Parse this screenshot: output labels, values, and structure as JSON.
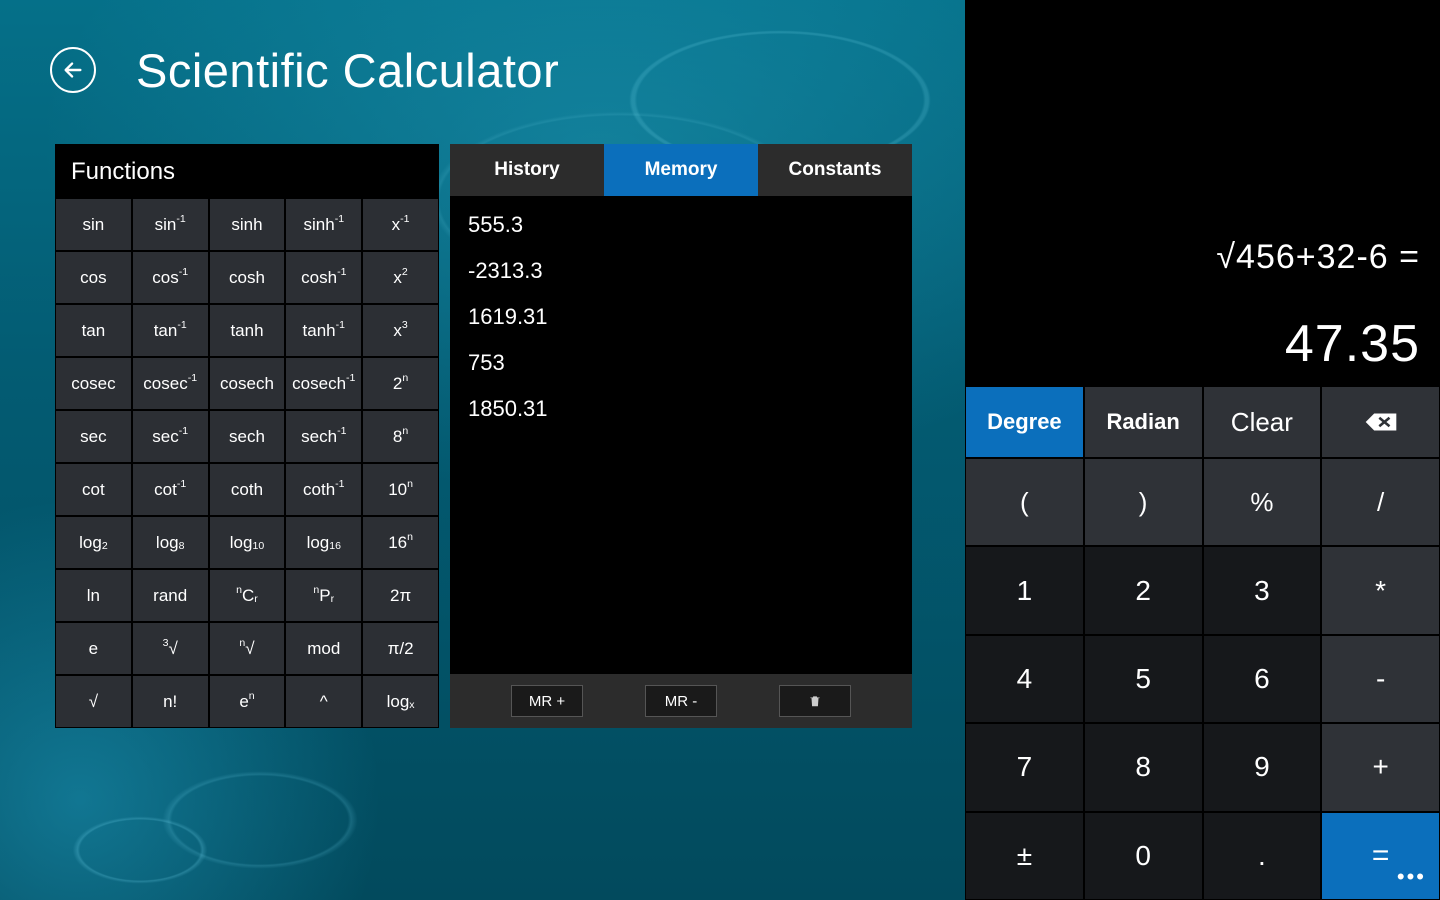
{
  "header": {
    "title": "Scientific Calculator"
  },
  "functions": {
    "title": "Functions",
    "rows": [
      [
        "sin",
        "sin<sup>-1</sup>",
        "sinh",
        "sinh<sup>-1</sup>",
        "x<sup>-1</sup>"
      ],
      [
        "cos",
        "cos<sup>-1</sup>",
        "cosh",
        "cosh<sup>-1</sup>",
        "x<sup>2</sup>"
      ],
      [
        "tan",
        "tan<sup>-1</sup>",
        "tanh",
        "tanh<sup>-1</sup>",
        "x<sup>3</sup>"
      ],
      [
        "cosec",
        "cosec<sup>-1</sup>",
        "cosech",
        "cosech<sup>-1</sup>",
        "2<sup>n</sup>"
      ],
      [
        "sec",
        "sec<sup>-1</sup>",
        "sech",
        "sech<sup>-1</sup>",
        "8<sup>n</sup>"
      ],
      [
        "cot",
        "cot<sup>-1</sup>",
        "coth",
        "coth<sup>-1</sup>",
        "10<sup>n</sup>"
      ],
      [
        "log<sub>2</sub>",
        "log<sub>8</sub>",
        "log<sub>10</sub>",
        "log<sub>16</sub>",
        "16<sup>n</sup>"
      ],
      [
        "ln",
        "rand",
        "<sup>n</sup>C<sub>r</sub>",
        "<sup>n</sup>P<sub>r</sub>",
        "2π"
      ],
      [
        "e",
        "<sup>3</sup>√",
        "<sup>n</sup>√",
        "mod",
        "π/2"
      ],
      [
        "√",
        "n!",
        "e<sup>n</sup>",
        "^",
        "log<sub>x</sub>"
      ]
    ]
  },
  "midpanel": {
    "tabs": {
      "history": "History",
      "memory": "Memory",
      "constants": "Constants"
    },
    "active_tab": "memory",
    "memory_items": [
      "555.3",
      "-2313.3",
      "1619.31",
      "753",
      "1850.31"
    ],
    "footer": {
      "mr_plus": "MR +",
      "mr_minus": "MR -"
    }
  },
  "display": {
    "expression": "√456+32-6 =",
    "result": "47.35"
  },
  "keypad": {
    "row0": {
      "degree": "Degree",
      "radian": "Radian",
      "clear": "Clear"
    },
    "row1": [
      "(",
      ")",
      "%",
      "/"
    ],
    "row2": [
      "1",
      "2",
      "3",
      "*"
    ],
    "row3": [
      "4",
      "5",
      "6",
      "-"
    ],
    "row4": [
      "7",
      "8",
      "9",
      "+"
    ],
    "row5": [
      "±",
      "0",
      ".",
      "="
    ]
  },
  "accent_color": "#0b6fbc"
}
